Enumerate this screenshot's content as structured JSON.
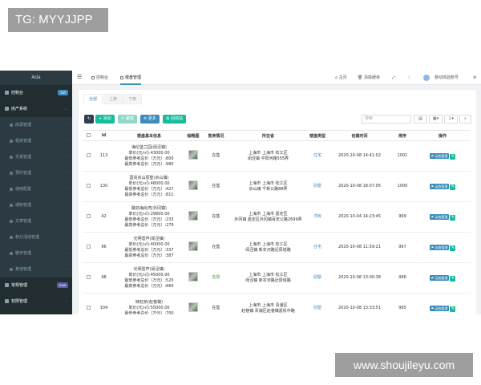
{
  "watermarks": {
    "top": "TG: MYYJJPP",
    "bottom": "www.shoujileyu.com"
  },
  "sidebar": {
    "brand": "Ada",
    "items": [
      {
        "label": "控制台",
        "badge": "hot",
        "badge_color": "#3c8dbc",
        "level": "main"
      },
      {
        "label": "房产系统",
        "level": "main",
        "expanded": true
      },
      {
        "label": "房源管理",
        "level": "sub"
      },
      {
        "label": "租房管理",
        "level": "sub"
      },
      {
        "label": "交易管理",
        "level": "sub"
      },
      {
        "label": "预约管理",
        "level": "sub"
      },
      {
        "label": "通用配置",
        "level": "sub"
      },
      {
        "label": "通知管理",
        "level": "sub"
      },
      {
        "label": "文章管理",
        "level": "sub"
      },
      {
        "label": "积分活动管理",
        "level": "sub"
      },
      {
        "label": "聊天管理",
        "level": "sub"
      },
      {
        "label": "其他管理",
        "level": "sub"
      },
      {
        "label": "常规管理",
        "badge": "new",
        "badge_color": "#605ca8",
        "level": "main"
      },
      {
        "label": "权限管理",
        "level": "main"
      }
    ]
  },
  "topbar": {
    "menu_icon": "☰",
    "tabs": [
      {
        "label": "控制台"
      },
      {
        "label": "楼盘管理",
        "active": true
      }
    ],
    "home": "主页",
    "clear_cache": "清除缓存",
    "user": "移动体验账号"
  },
  "content": {
    "tabs": [
      {
        "label": "全部",
        "active": true
      },
      {
        "label": "上架"
      },
      {
        "label": "下架"
      }
    ],
    "buttons": {
      "refresh": "↻",
      "add": "+ 添加",
      "edit": "✎ 编辑",
      "more": "≡ 更多",
      "recycle": "♻ 回收站"
    },
    "search_placeholder": "搜索",
    "columns": [
      "",
      "Id",
      "楼盘基本信息",
      "缩略图",
      "售卖情况",
      "所在省",
      "楼盘类型",
      "创建时间",
      "排序",
      "操作"
    ],
    "action_label": "⚑ 动态管理",
    "rows": [
      {
        "id": "113",
        "info": [
          "海伦堡兰园(闵泾镇)",
          "单价(元/㎡):43000.00",
          "最低参考总价（万元）:800",
          "最高参考总价（万元）:980"
        ],
        "status": "在售",
        "status_color": "#333",
        "address": [
          "上海市 上海市 松江区",
          "闵泾镇 平阳河路555弄"
        ],
        "type": "住宅",
        "created": "2020-10-08 14:41:02",
        "sort": "1001"
      },
      {
        "id": "130",
        "info": [
          "国贸佘山原墅(佘山镇)",
          "单价(元/㎡):48000.00",
          "最低参考总价（万元）:427",
          "最高参考总价（万元）:811"
        ],
        "status": "在售",
        "status_color": "#333",
        "address": [
          "上海市 上海市 松江区",
          "佘山镇 千新公路88弄"
        ],
        "type": "别墅",
        "created": "2020-10-08 18:07:05",
        "sort": "1000"
      },
      {
        "id": "42",
        "info": [
          "路劲海尚湾(外冈镇)",
          "单价(元/㎡):29800.00",
          "最低参考总价（万元）:233",
          "最高参考总价（万元）:279"
        ],
        "status": "在售",
        "status_color": "#333",
        "address": [
          "上海市 上海市 嘉定区",
          "外冈镇 嘉定区外冈镇百安公路2699弄"
        ],
        "type": "洋房",
        "created": "2020-10-04 14:23:45",
        "sort": "999"
      },
      {
        "id": "96",
        "info": [
          "光明雷芦(闵泾镇)",
          "单价(元/㎡):40000.00",
          "最低参考总价（万元）:337",
          "最高参考总价（万元）:387"
        ],
        "status": "在售",
        "status_color": "#333",
        "address": [
          "上海市 上海市 松江区",
          "闵泾镇 新农河路近辰塔路"
        ],
        "type": "住宅",
        "created": "2020-10-08 11:59:21",
        "sort": "997"
      },
      {
        "id": "98",
        "info": [
          "光明雷芦(闵泾镇)",
          "单价(元/㎡):45000.00",
          "最低参考总价（万元）:520",
          "最高参考总价（万元）:660"
        ],
        "status": "售罄",
        "status_color": "#5aa65f",
        "address": [
          "上海市 上海市 松江区",
          "闵泾镇 新农河路近辰塔路"
        ],
        "type": "别墅",
        "created": "2020-10-08 13:00:38",
        "sort": "996"
      },
      {
        "id": "104",
        "info": [
          "映虹桥(赵巷镇)",
          "单价(元/㎡):55000.00",
          "最低参考总价（万元）:700",
          ""
        ],
        "status": "在售",
        "status_color": "#333",
        "address": [
          "上海市 上海市 青浦区",
          "赵巷镇 青浦区赵巷镇嘉松中路"
        ],
        "type": "别墅",
        "created": "2020-10-08 13:33:51",
        "sort": "995"
      }
    ]
  }
}
